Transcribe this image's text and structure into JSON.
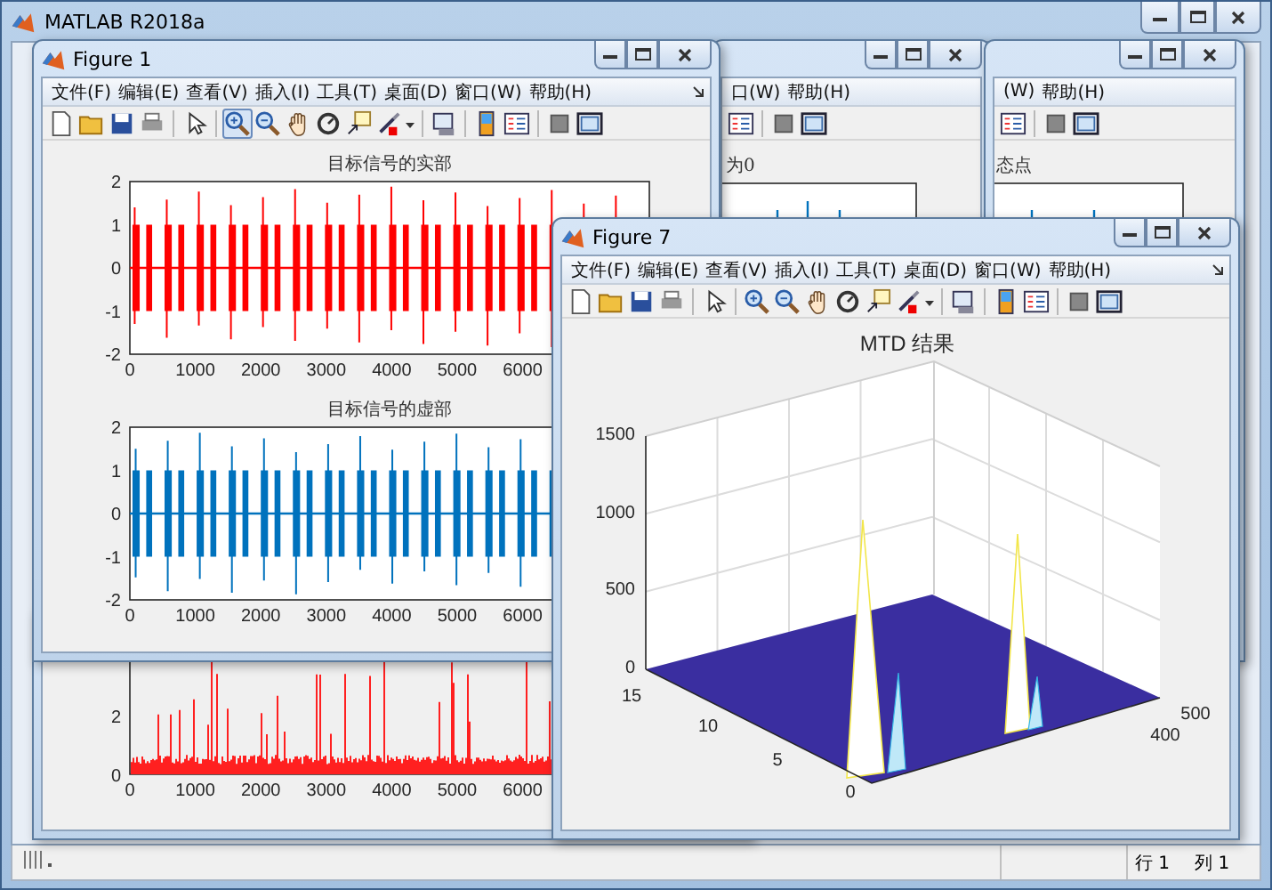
{
  "main_window": {
    "title": "MATLAB R2018a",
    "status_bar": {
      "row": "行 1",
      "column": "列 1"
    }
  },
  "figures": [
    {
      "kind": "noise",
      "plot": {
        "yticks": [
          "2",
          "0"
        ],
        "xticks": [
          "0",
          "1000",
          "2000",
          "3000",
          "4000",
          "5000",
          "6000"
        ]
      }
    },
    {
      "kind": "stems",
      "menu": [
        "口(W)",
        "帮助(H)"
      ],
      "plot": {
        "title": "为0"
      }
    },
    {
      "kind": "stems",
      "menu": [
        "(W)",
        "帮助(H)"
      ],
      "plot": {
        "title": "态点"
      }
    },
    {
      "kind": "waves",
      "title": "Figure 1",
      "menu": [
        "文件(F)",
        "编辑(E)",
        "查看(V)",
        "插入(I)",
        "工具(T)",
        "桌面(D)",
        "窗口(W)",
        "帮助(H)"
      ],
      "zoom_in_active": true,
      "axes": [
        {
          "title": "目标信号的实部",
          "color": "#ff0000",
          "yticks": [
            "2",
            "1",
            "0",
            "-1",
            "-2"
          ],
          "xticks": [
            "0",
            "1000",
            "2000",
            "3000",
            "4000",
            "5000",
            "6000"
          ]
        },
        {
          "title": "目标信号的虚部",
          "color": "#0072bd",
          "yticks": [
            "2",
            "1",
            "0",
            "-1",
            "-2"
          ],
          "xticks": [
            "0",
            "1000",
            "2000",
            "3000",
            "4000",
            "5000",
            "6000"
          ]
        }
      ]
    },
    {
      "kind": "surface",
      "title": "Figure 7",
      "menu": [
        "文件(F)",
        "编辑(E)",
        "查看(V)",
        "插入(I)",
        "工具(T)",
        "桌面(D)",
        "窗口(W)",
        "帮助(H)"
      ],
      "zoom_in_active": false,
      "plot": {
        "title": "MTD 结果",
        "zticks": [
          "1500",
          "1000",
          "500",
          "0"
        ],
        "yticks": [
          "15",
          "10",
          "5",
          "0"
        ],
        "xticks": [
          "400",
          "500"
        ]
      }
    }
  ]
}
